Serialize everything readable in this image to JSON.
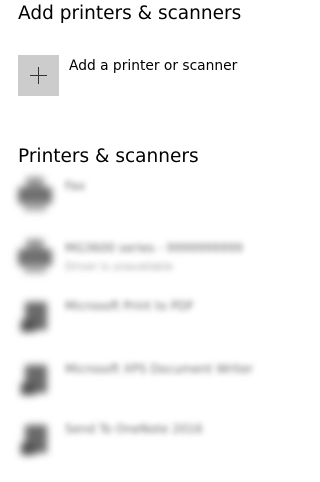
{
  "add_section": {
    "heading": "Add printers & scanners",
    "add_button_label": "Add a printer or scanner",
    "add_icon": "plus-icon"
  },
  "printers_section": {
    "heading": "Printers & scanners",
    "devices": [
      {
        "name": "Fax",
        "status": "",
        "icon": "printer-icon"
      },
      {
        "name": "MG3600 series - 9999999999",
        "status": "Driver is unavailable",
        "icon": "printer-icon"
      },
      {
        "name": "Microsoft Print to PDF",
        "status": "",
        "icon": "document-printer-icon"
      },
      {
        "name": "Microsoft XPS Document Writer",
        "status": "",
        "icon": "document-printer-icon"
      },
      {
        "name": "Send To OneNote 2016",
        "status": "",
        "icon": "document-printer-icon"
      }
    ]
  },
  "colors": {
    "add_tile_background": "#cccccc",
    "plus_glyph": "#333333",
    "text_primary": "#000000"
  }
}
